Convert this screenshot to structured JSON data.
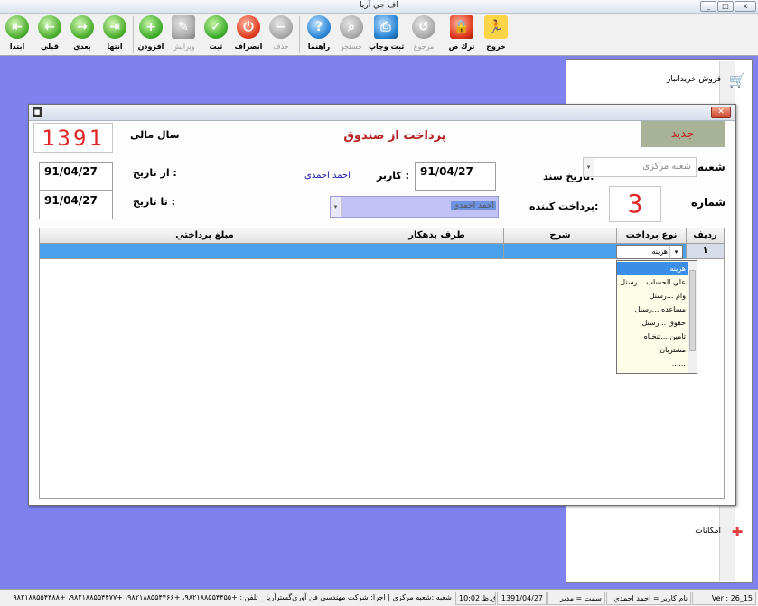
{
  "window": {
    "title": "اف جي آريا",
    "minimize": "_",
    "maximize": "□",
    "close": "x"
  },
  "toolbar": {
    "nav": {
      "first": "ابتدا",
      "prev": "قبلي",
      "next": "بعدي",
      "last": "انتها"
    },
    "actions": {
      "add": "افزودن",
      "edit": "ويرايش",
      "save": "ثبت",
      "cancel": "انصراف",
      "delete": "حذف"
    },
    "tools": {
      "help": "راهنما",
      "search": "جستجو",
      "print": "ثبت وچاپ",
      "reference": "مرجوع",
      "leave": "ترك ص",
      "exit": "خروج"
    }
  },
  "side_menu": {
    "items": [
      "فروش خريدانبار",
      "امكانات"
    ]
  },
  "dialog": {
    "title": "پرداخت از صندوق",
    "status_badge": "جديد",
    "fiscal_year_label": "سال مالی",
    "fiscal_year": "1391",
    "from_date_label": "از تاریخ :",
    "from_date": "91/04/27",
    "to_date_label": "تا تاریخ :",
    "to_date": "91/04/27",
    "user_label": "كاربر :",
    "user_name": "احمد احمدی",
    "doc_date_label": "تاریخ سند:",
    "doc_date": "91/04/27",
    "branch_label": "شعبه",
    "branch_value": "شعبه مرکزی",
    "number_label": "شماره",
    "number_value": "3",
    "payer_label": "پرداخت كننده:",
    "payer_value": "احمد احمدي",
    "grid": {
      "columns": [
        "رديف",
        "نوع پرداخت",
        "شرح",
        "طرف بدهكار",
        "مبلغ پرداختي"
      ],
      "rows": [
        {
          "row": "١",
          "type": "هزينه",
          "desc": "",
          "debtor": "",
          "amount": ""
        }
      ]
    },
    "dropdown_options": [
      "هزينه",
      "علي الحساب ...رسنل",
      "وام ...رسنل",
      "مساعده ...رسنل",
      "حقوق ...رسنل",
      "تامين ...تنخـاه",
      "مشتريان",
      "......"
    ]
  },
  "statusbar": {
    "version": "Ver : 26_15",
    "user": "نام كاربر = احمد احمدي",
    "role": "سمت = مدير",
    "date": "1391/04/27",
    "time": "ق.ظ 10:02",
    "info": "شعبه :شعبه مركزي | اجرا: شركت مهندسي فن آوري‌گسترآريا _ تلفن : +۹۸۲۱۸۸۵۵۴۴۵۵، +۹۸۲۱۸۸۵۵۴۴۶۶، +۹۸۲۱۸۸۵۵۴۴۷۷، +۹۸۲۱۸۸۵۵۴۴۸۸"
  }
}
